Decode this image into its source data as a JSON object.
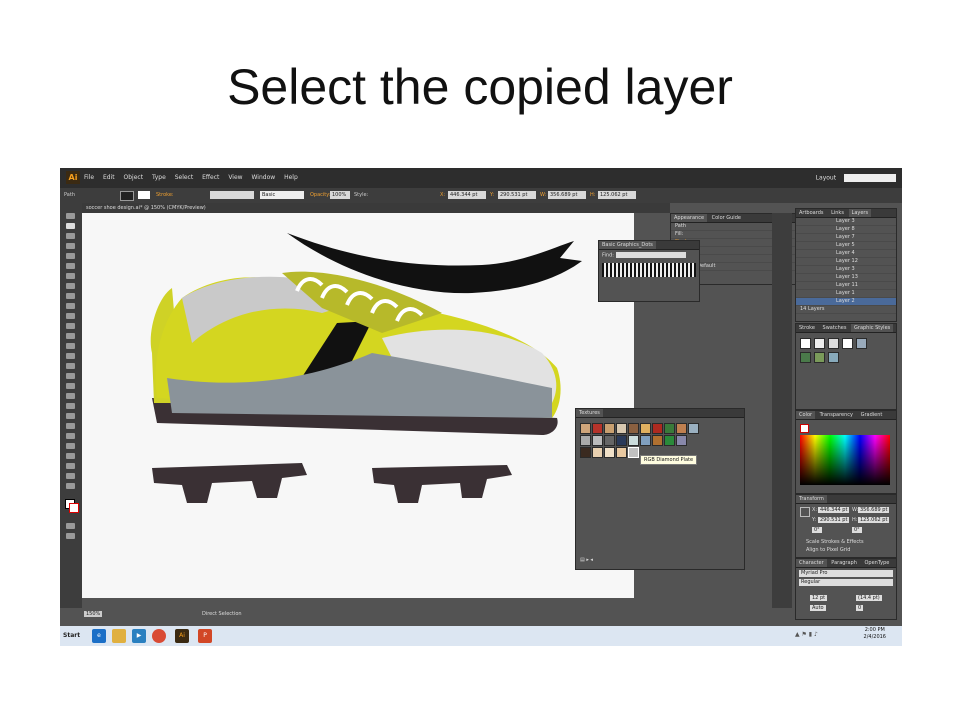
{
  "slide": {
    "title": "Select the copied layer"
  },
  "app": {
    "logo": "Ai",
    "menu": [
      "File",
      "Edit",
      "Object",
      "Type",
      "Select",
      "Effect",
      "View",
      "Window",
      "Help"
    ],
    "workspace": "Layout",
    "control_bar": {
      "object_type": "Path",
      "stroke_label": "Stroke:",
      "brush_label": "Basic",
      "opacity_label": "Opacity:",
      "opacity_value": "100%",
      "style_label": "Style:",
      "x_label": "X:",
      "x_value": "446.344 pt",
      "y_label": "Y:",
      "y_value": "290.531 pt",
      "w_label": "W:",
      "w_value": "356.689 pt",
      "h_label": "H:",
      "h_value": "125.062 pt"
    },
    "document_tab": "soccer shoe design.ai* @ 150% (CMYK/Preview)",
    "status": {
      "zoom": "150%",
      "mode": "Direct Selection"
    }
  },
  "panels": {
    "appearance": {
      "tabs": [
        "Appearance",
        "Color Guide"
      ],
      "rows": [
        "Path",
        "Fill:",
        "Strokes",
        "Fill:",
        "Stroke:",
        "Opacity: Default"
      ]
    },
    "graphics_dots": {
      "title": "Basic Graphics_Dots",
      "find_label": "Find:"
    },
    "textures": {
      "title": "Textures",
      "tooltip": "RGB Diamond Plate"
    },
    "layers": {
      "tabs": [
        "Artboards",
        "Links",
        "Layers"
      ],
      "items": [
        "Layer 3",
        "Layer 8",
        "Layer 7",
        "Layer 5",
        "Layer 4",
        "Layer 12",
        "Layer 3",
        "Layer 13",
        "Layer 11",
        "Layer 1",
        "Layer 2"
      ],
      "count": "14 Layers"
    },
    "graphic_styles": {
      "tabs": [
        "Stroke",
        "Swatches",
        "Graphic Styles"
      ]
    },
    "color": {
      "tabs": [
        "Color",
        "Transparency",
        "Gradient"
      ]
    },
    "transform": {
      "title": "Transform",
      "x_label": "X:",
      "x_value": "446.344 pt",
      "w_label": "W:",
      "w_value": "356.689 pt",
      "y_label": "Y:",
      "y_value": "290.531 pt",
      "h_label": "H:",
      "h_value": "125.062 pt",
      "angle": "0°",
      "shear": "0°",
      "scale_strokes": "Scale Strokes & Effects",
      "align_pixel": "Align to Pixel Grid"
    },
    "character": {
      "tabs": [
        "Character",
        "Paragraph",
        "OpenType"
      ],
      "font": "Myriad Pro",
      "style": "Regular",
      "size": "12 pt",
      "leading": "(14.4 pt)",
      "kerning": "Auto",
      "tracking": "0"
    }
  },
  "taskbar": {
    "start": "Start",
    "time": "2:00 PM",
    "date": "2/4/2016",
    "apps": [
      {
        "name": "ie",
        "color": "#1b6fc7"
      },
      {
        "name": "explorer",
        "color": "#e0b040"
      },
      {
        "name": "media",
        "color": "#2a80c0"
      },
      {
        "name": "chrome",
        "color": "#d94b35"
      },
      {
        "name": "illustrator",
        "color": "#3b2a12"
      },
      {
        "name": "powerpoint",
        "color": "#d24726"
      }
    ]
  },
  "colors": {
    "shoe_yellow": "#d4d620",
    "shoe_gray": "#8a939a",
    "shoe_dark": "#3a3034",
    "ui_panel": "#535353",
    "ui_dark": "#2d2d2d"
  }
}
